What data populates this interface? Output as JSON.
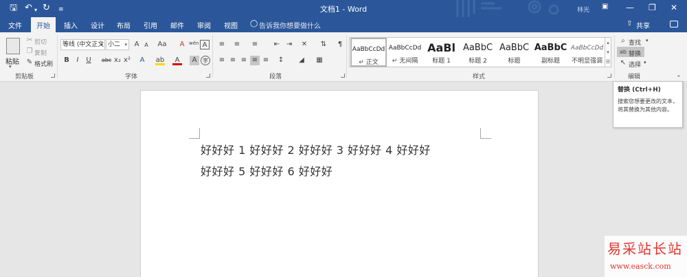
{
  "window": {
    "title": "文档1 - Word",
    "user": "林光",
    "accent": "#2b579a"
  },
  "quick_access": {
    "save_icon": "save-icon",
    "undo_icon": "undo-icon",
    "redo_icon": "redo-icon",
    "customize_icon": "customize-icon"
  },
  "tabs": [
    {
      "label": "文件"
    },
    {
      "label": "开始"
    },
    {
      "label": "插入"
    },
    {
      "label": "设计"
    },
    {
      "label": "布局"
    },
    {
      "label": "引用"
    },
    {
      "label": "邮件"
    },
    {
      "label": "审阅"
    },
    {
      "label": "视图"
    }
  ],
  "tell_me": "告诉我你想要做什么",
  "share_label": "共享",
  "clipboard": {
    "paste": "粘贴",
    "cut": "剪切",
    "copy": "复制",
    "format_painter": "格式刷",
    "group": "剪贴板"
  },
  "font": {
    "name": "等线 (中文正文)",
    "size": "小二",
    "grow": "A",
    "shrink": "A",
    "case": "Aa",
    "clear": "A",
    "phonetic": "wén",
    "border_char": "A",
    "bold": "B",
    "italic": "I",
    "underline": "U",
    "strike": "abc",
    "subscript": "x₂",
    "superscript": "x²",
    "effects": "A",
    "highlight": "ab",
    "font_color": "A",
    "shading": "A",
    "enclose": "字",
    "group": "字体"
  },
  "paragraph": {
    "group": "段落"
  },
  "styles": {
    "items": [
      {
        "sample": "AaBbCcDd",
        "name": "↵ 正文"
      },
      {
        "sample": "AaBbCcDd",
        "name": "↵ 无间隔"
      },
      {
        "sample": "AaBl",
        "name": "标题 1"
      },
      {
        "sample": "AaBbC",
        "name": "标题 2"
      },
      {
        "sample": "AaBbC",
        "name": "标题"
      },
      {
        "sample": "AaBbC",
        "name": "副标题"
      },
      {
        "sample": "AaBbCcDd",
        "name": "不明显强调"
      }
    ],
    "group": "样式"
  },
  "editing": {
    "find": "查找",
    "replace": "替换",
    "select": "选择",
    "group": "编辑"
  },
  "tooltip": {
    "title": "替换 (Ctrl+H)",
    "body": "搜索您想要更改的文本，将其替换为其他内容。"
  },
  "document": {
    "lines": [
      "好好好 1 好好好 2 好好好 3 好好好 4 好好好",
      "好好好 5 好好好 6 好好好"
    ]
  },
  "watermark": {
    "brand": "易采站长站",
    "url": "www.easck.com"
  }
}
